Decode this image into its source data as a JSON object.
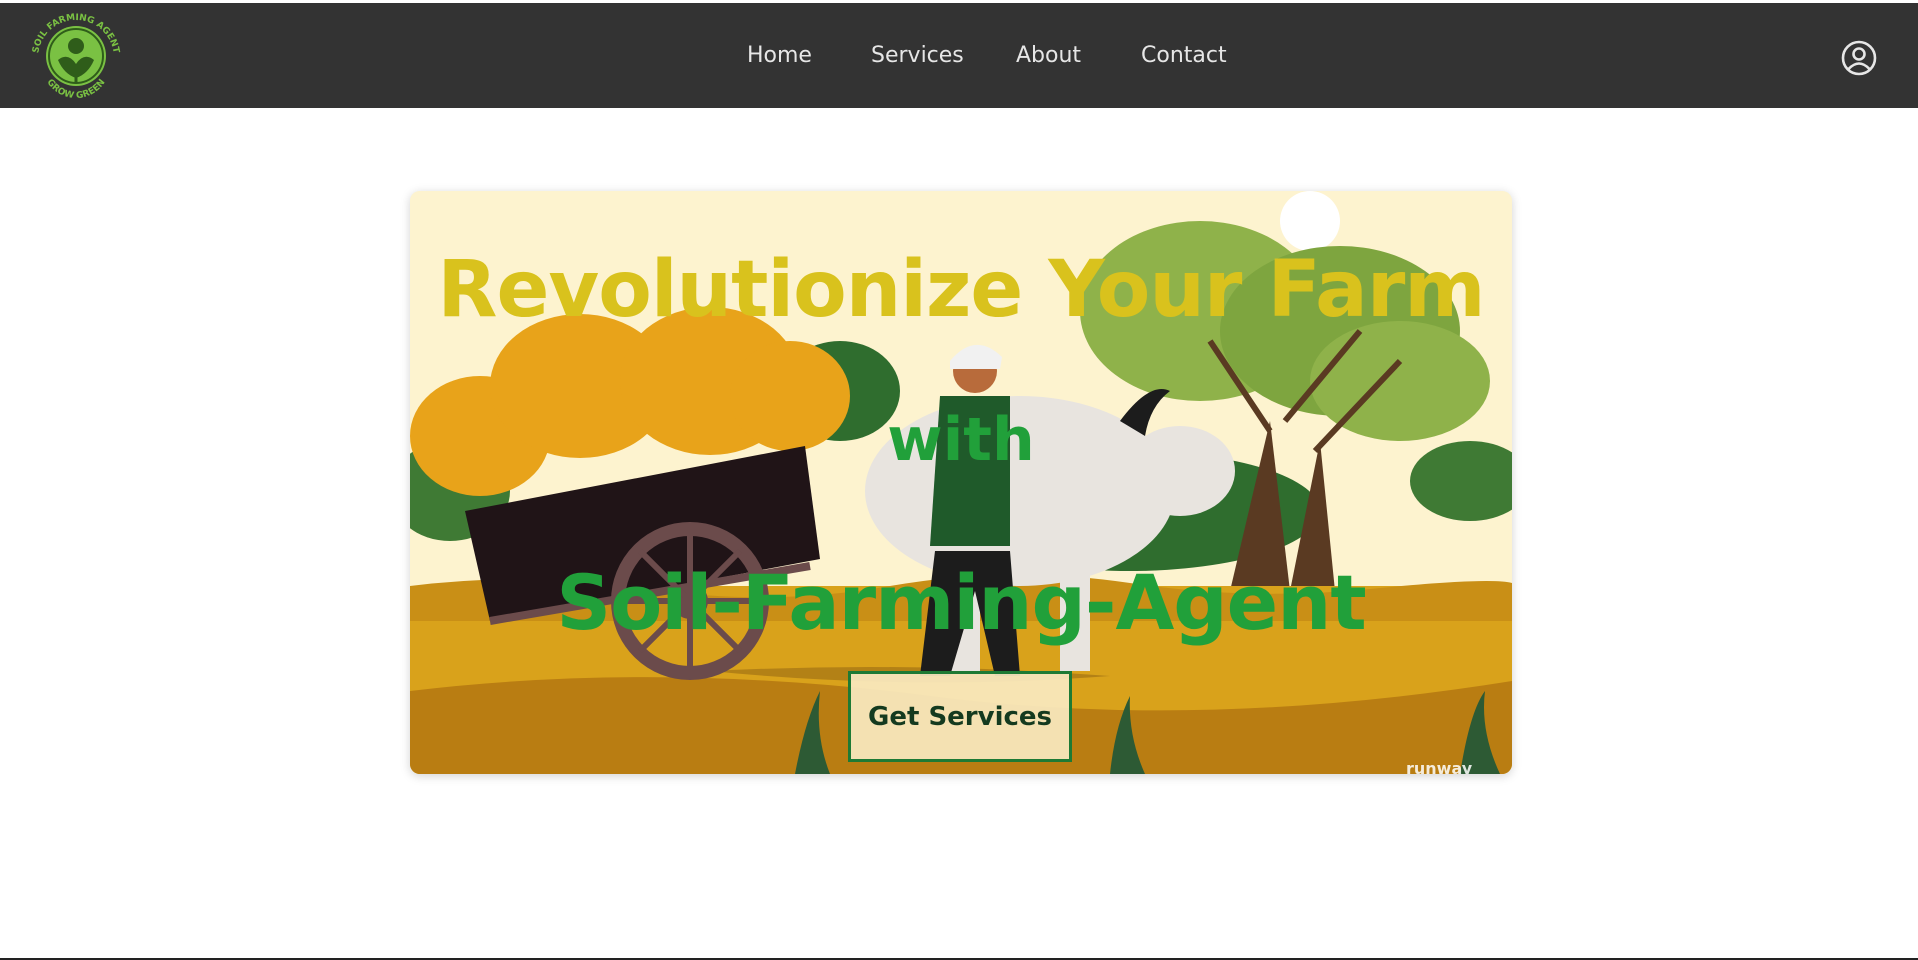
{
  "brand": {
    "logo_ring_text": "SOIL FARMING AGENT",
    "logo_bottom_text": "GROW GREEN",
    "logo_icon": "soil-farming-agent-logo"
  },
  "nav": {
    "items": [
      {
        "label": "Home"
      },
      {
        "label": "Services"
      },
      {
        "label": "About"
      },
      {
        "label": "Contact"
      }
    ],
    "user_icon": "user-circle-icon"
  },
  "hero": {
    "line1": "Revolutionize Your Farm",
    "line2": "with",
    "line3": "Soil-Farming-Agent",
    "cta_label": "Get Services",
    "watermark": "runway"
  },
  "colors": {
    "topbar": "#333333",
    "headline_yellow": "#d9c21d",
    "headline_green": "#21a03a",
    "logo_green": "#7ac143"
  }
}
